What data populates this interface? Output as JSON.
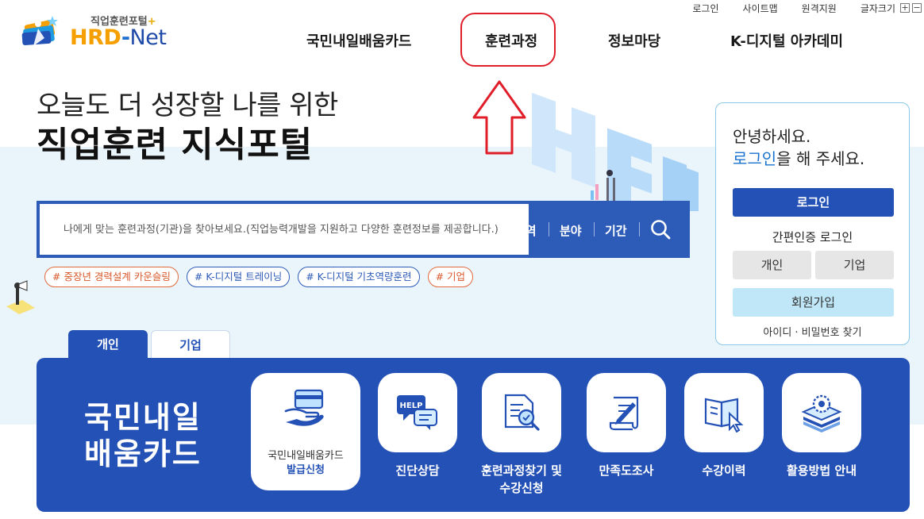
{
  "utility": {
    "login": "로그인",
    "sitemap": "사이트맵",
    "remote": "원격지원",
    "font_size": "글자크기",
    "plus": "+",
    "minus": "−"
  },
  "logo": {
    "sub_text": "직업훈련포털",
    "sub_plus": "+",
    "brand_hrd": "HRD",
    "brand_dash": "-",
    "brand_net": "Net"
  },
  "nav": [
    "국민내일배움카드",
    "훈련과정",
    "정보마당",
    "K-디지털 아카데미"
  ],
  "hero": {
    "line1": "오늘도 더 성장할 나를 위한",
    "line2": "직업훈련 지식포털"
  },
  "search": {
    "placeholder": "나에게 맞는 훈련과정(기관)을 찾아보세요.(직업능력개발을 지원하고 다양한 훈련정보를 제공합니다.)",
    "filters": [
      "지역",
      "분야",
      "기간"
    ]
  },
  "tags": [
    "# 중장년 경력설계 카운슬링",
    "# K-디지털 트레이닝",
    "# K-디지털 기초역량훈련",
    "# 기업"
  ],
  "login_box": {
    "greet1": "안녕하세요.",
    "greet2_link": "로그인",
    "greet2_rest": "을 해 주세요.",
    "login_btn": "로그인",
    "easy_title": "간편인증 로그인",
    "personal": "개인",
    "company": "기업",
    "join": "회원가입",
    "find": "아이디 · 비밀번호 찾기"
  },
  "tabs": {
    "personal": "개인",
    "company": "기업"
  },
  "panel": {
    "title_line1": "국민내일",
    "title_line2": "배움카드",
    "featured": {
      "line1": "국민내일배움카드",
      "line2": "발급신청"
    },
    "items": [
      "진단상담",
      "훈련과정찾기 및",
      "수강신청",
      "만족도조사",
      "수강이력",
      "활용방법 안내"
    ]
  },
  "colors": {
    "primary": "#2451b5",
    "highlight": "#e01e2a",
    "band": "#e9f4fb",
    "accent_orange": "#f5a000"
  }
}
